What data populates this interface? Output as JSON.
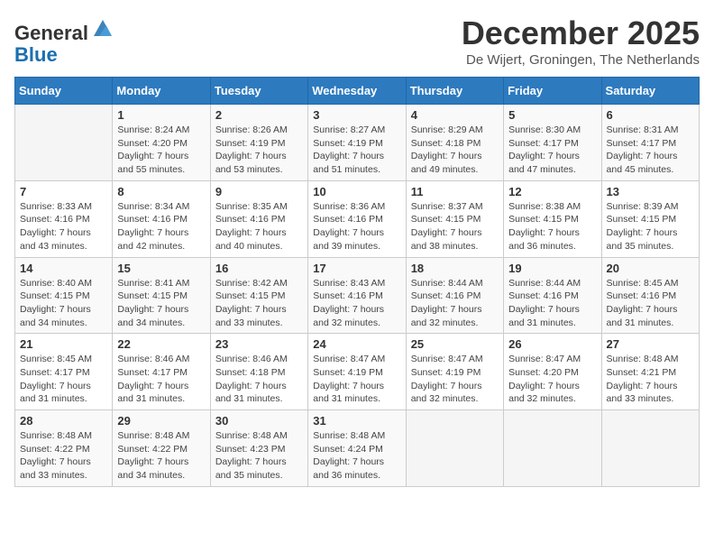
{
  "header": {
    "logo_general": "General",
    "logo_blue": "Blue",
    "month_title": "December 2025",
    "subtitle": "De Wijert, Groningen, The Netherlands"
  },
  "calendar": {
    "headers": [
      "Sunday",
      "Monday",
      "Tuesday",
      "Wednesday",
      "Thursday",
      "Friday",
      "Saturday"
    ],
    "weeks": [
      [
        {
          "day": "",
          "sunrise": "",
          "sunset": "",
          "daylight": "",
          "empty": true
        },
        {
          "day": "1",
          "sunrise": "Sunrise: 8:24 AM",
          "sunset": "Sunset: 4:20 PM",
          "daylight": "Daylight: 7 hours and 55 minutes."
        },
        {
          "day": "2",
          "sunrise": "Sunrise: 8:26 AM",
          "sunset": "Sunset: 4:19 PM",
          "daylight": "Daylight: 7 hours and 53 minutes."
        },
        {
          "day": "3",
          "sunrise": "Sunrise: 8:27 AM",
          "sunset": "Sunset: 4:19 PM",
          "daylight": "Daylight: 7 hours and 51 minutes."
        },
        {
          "day": "4",
          "sunrise": "Sunrise: 8:29 AM",
          "sunset": "Sunset: 4:18 PM",
          "daylight": "Daylight: 7 hours and 49 minutes."
        },
        {
          "day": "5",
          "sunrise": "Sunrise: 8:30 AM",
          "sunset": "Sunset: 4:17 PM",
          "daylight": "Daylight: 7 hours and 47 minutes."
        },
        {
          "day": "6",
          "sunrise": "Sunrise: 8:31 AM",
          "sunset": "Sunset: 4:17 PM",
          "daylight": "Daylight: 7 hours and 45 minutes."
        }
      ],
      [
        {
          "day": "7",
          "sunrise": "Sunrise: 8:33 AM",
          "sunset": "Sunset: 4:16 PM",
          "daylight": "Daylight: 7 hours and 43 minutes."
        },
        {
          "day": "8",
          "sunrise": "Sunrise: 8:34 AM",
          "sunset": "Sunset: 4:16 PM",
          "daylight": "Daylight: 7 hours and 42 minutes."
        },
        {
          "day": "9",
          "sunrise": "Sunrise: 8:35 AM",
          "sunset": "Sunset: 4:16 PM",
          "daylight": "Daylight: 7 hours and 40 minutes."
        },
        {
          "day": "10",
          "sunrise": "Sunrise: 8:36 AM",
          "sunset": "Sunset: 4:16 PM",
          "daylight": "Daylight: 7 hours and 39 minutes."
        },
        {
          "day": "11",
          "sunrise": "Sunrise: 8:37 AM",
          "sunset": "Sunset: 4:15 PM",
          "daylight": "Daylight: 7 hours and 38 minutes."
        },
        {
          "day": "12",
          "sunrise": "Sunrise: 8:38 AM",
          "sunset": "Sunset: 4:15 PM",
          "daylight": "Daylight: 7 hours and 36 minutes."
        },
        {
          "day": "13",
          "sunrise": "Sunrise: 8:39 AM",
          "sunset": "Sunset: 4:15 PM",
          "daylight": "Daylight: 7 hours and 35 minutes."
        }
      ],
      [
        {
          "day": "14",
          "sunrise": "Sunrise: 8:40 AM",
          "sunset": "Sunset: 4:15 PM",
          "daylight": "Daylight: 7 hours and 34 minutes."
        },
        {
          "day": "15",
          "sunrise": "Sunrise: 8:41 AM",
          "sunset": "Sunset: 4:15 PM",
          "daylight": "Daylight: 7 hours and 34 minutes."
        },
        {
          "day": "16",
          "sunrise": "Sunrise: 8:42 AM",
          "sunset": "Sunset: 4:15 PM",
          "daylight": "Daylight: 7 hours and 33 minutes."
        },
        {
          "day": "17",
          "sunrise": "Sunrise: 8:43 AM",
          "sunset": "Sunset: 4:16 PM",
          "daylight": "Daylight: 7 hours and 32 minutes."
        },
        {
          "day": "18",
          "sunrise": "Sunrise: 8:44 AM",
          "sunset": "Sunset: 4:16 PM",
          "daylight": "Daylight: 7 hours and 32 minutes."
        },
        {
          "day": "19",
          "sunrise": "Sunrise: 8:44 AM",
          "sunset": "Sunset: 4:16 PM",
          "daylight": "Daylight: 7 hours and 31 minutes."
        },
        {
          "day": "20",
          "sunrise": "Sunrise: 8:45 AM",
          "sunset": "Sunset: 4:16 PM",
          "daylight": "Daylight: 7 hours and 31 minutes."
        }
      ],
      [
        {
          "day": "21",
          "sunrise": "Sunrise: 8:45 AM",
          "sunset": "Sunset: 4:17 PM",
          "daylight": "Daylight: 7 hours and 31 minutes."
        },
        {
          "day": "22",
          "sunrise": "Sunrise: 8:46 AM",
          "sunset": "Sunset: 4:17 PM",
          "daylight": "Daylight: 7 hours and 31 minutes."
        },
        {
          "day": "23",
          "sunrise": "Sunrise: 8:46 AM",
          "sunset": "Sunset: 4:18 PM",
          "daylight": "Daylight: 7 hours and 31 minutes."
        },
        {
          "day": "24",
          "sunrise": "Sunrise: 8:47 AM",
          "sunset": "Sunset: 4:19 PM",
          "daylight": "Daylight: 7 hours and 31 minutes."
        },
        {
          "day": "25",
          "sunrise": "Sunrise: 8:47 AM",
          "sunset": "Sunset: 4:19 PM",
          "daylight": "Daylight: 7 hours and 32 minutes."
        },
        {
          "day": "26",
          "sunrise": "Sunrise: 8:47 AM",
          "sunset": "Sunset: 4:20 PM",
          "daylight": "Daylight: 7 hours and 32 minutes."
        },
        {
          "day": "27",
          "sunrise": "Sunrise: 8:48 AM",
          "sunset": "Sunset: 4:21 PM",
          "daylight": "Daylight: 7 hours and 33 minutes."
        }
      ],
      [
        {
          "day": "28",
          "sunrise": "Sunrise: 8:48 AM",
          "sunset": "Sunset: 4:22 PM",
          "daylight": "Daylight: 7 hours and 33 minutes."
        },
        {
          "day": "29",
          "sunrise": "Sunrise: 8:48 AM",
          "sunset": "Sunset: 4:22 PM",
          "daylight": "Daylight: 7 hours and 34 minutes."
        },
        {
          "day": "30",
          "sunrise": "Sunrise: 8:48 AM",
          "sunset": "Sunset: 4:23 PM",
          "daylight": "Daylight: 7 hours and 35 minutes."
        },
        {
          "day": "31",
          "sunrise": "Sunrise: 8:48 AM",
          "sunset": "Sunset: 4:24 PM",
          "daylight": "Daylight: 7 hours and 36 minutes."
        },
        {
          "day": "",
          "sunrise": "",
          "sunset": "",
          "daylight": "",
          "empty": true
        },
        {
          "day": "",
          "sunrise": "",
          "sunset": "",
          "daylight": "",
          "empty": true
        },
        {
          "day": "",
          "sunrise": "",
          "sunset": "",
          "daylight": "",
          "empty": true
        }
      ]
    ]
  }
}
